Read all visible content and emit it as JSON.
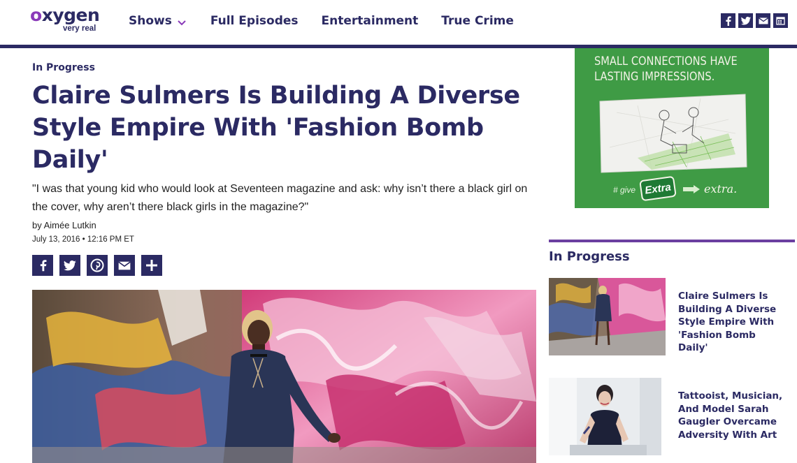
{
  "header": {
    "logo_word": "xygen",
    "logo_letter": "o",
    "logo_tagline": "very real",
    "nav": [
      {
        "label": "Shows",
        "has_dropdown": true
      },
      {
        "label": "Full Episodes"
      },
      {
        "label": "Entertainment"
      },
      {
        "label": "True Crime"
      }
    ],
    "social_icons": [
      "facebook-icon",
      "twitter-icon",
      "email-icon",
      "calendar-icon"
    ]
  },
  "article": {
    "kicker": "In Progress",
    "title": "Claire Sulmers Is Building A Diverse Style Empire With 'Fashion Bomb Daily'",
    "dek": "\"I was that young kid who would look at Seventeen magazine and ask: why isn’t there a black girl on the cover, why aren’t there black girls in the magazine?\"",
    "byline": "by Aimée Lutkin",
    "date": "July 13, 2016 • 12:16 PM ET",
    "share_icons": [
      "facebook-icon",
      "twitter-icon",
      "pinterest-icon",
      "email-icon",
      "plus-icon"
    ]
  },
  "ad": {
    "headline_1": "SMALL CONNECTIONS HAVE",
    "headline_2": "LASTING IMPRESSIONS.",
    "give": "# give",
    "brand": "Extra",
    "script": "extra."
  },
  "sidebar": {
    "title": "In Progress",
    "items": [
      {
        "title": "Claire Sulmers Is Building A Diverse Style Empire With 'Fashion Bomb Daily'"
      },
      {
        "title": "Tattooist, Musician, And Model Sarah Gaugler Overcame Adversity With Art"
      }
    ]
  },
  "colors": {
    "brand_navy": "#2b2a63",
    "brand_purple": "#8a3ab9",
    "sidebar_rule": "#6b3fa0",
    "ad_green": "#3f9b45"
  }
}
